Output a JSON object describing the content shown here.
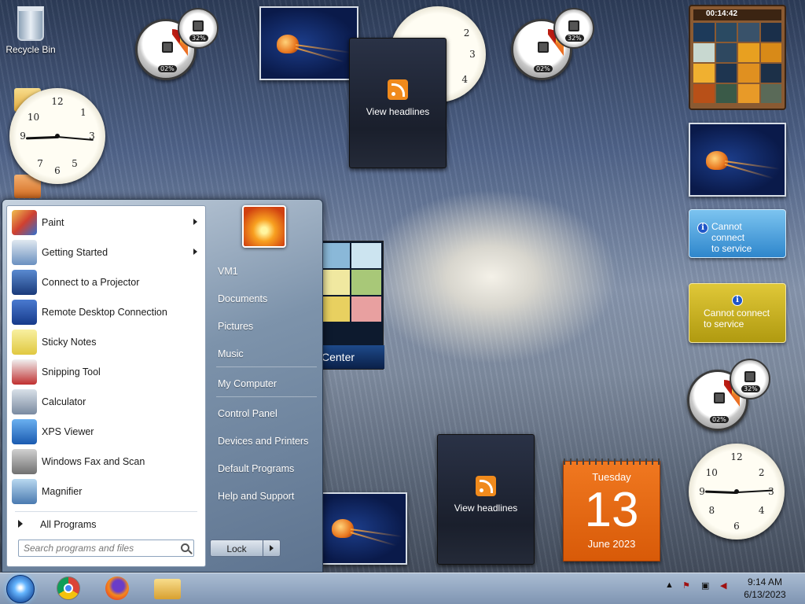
{
  "desktop": {
    "recycle_bin_label": "Recycle Bin",
    "meter_cpu": "02%",
    "meter_mem": "32%",
    "feed_label": "View headlines",
    "weather_msg_line1": "Cannot connect",
    "weather_msg_line2": "to service",
    "puzzle_time": "00:14:42",
    "media_center_label": "Center",
    "calendar_day": "Tuesday",
    "calendar_date": "13",
    "calendar_month": "June 2023"
  },
  "start_menu": {
    "programs": [
      {
        "label": "Paint",
        "icon": "paint-icon",
        "arrow": true
      },
      {
        "label": "Getting Started",
        "icon": "getting-started-icon",
        "arrow": true
      },
      {
        "label": "Connect to a Projector",
        "icon": "projector-icon",
        "arrow": false
      },
      {
        "label": "Remote Desktop Connection",
        "icon": "remote-desktop-icon",
        "arrow": false
      },
      {
        "label": "Sticky Notes",
        "icon": "sticky-notes-icon",
        "arrow": false
      },
      {
        "label": "Snipping Tool",
        "icon": "snipping-tool-icon",
        "arrow": false
      },
      {
        "label": "Calculator",
        "icon": "calculator-icon",
        "arrow": false
      },
      {
        "label": "XPS Viewer",
        "icon": "xps-viewer-icon",
        "arrow": false
      },
      {
        "label": "Windows Fax and Scan",
        "icon": "fax-scan-icon",
        "arrow": false
      },
      {
        "label": "Magnifier",
        "icon": "magnifier-icon",
        "arrow": false
      }
    ],
    "all_programs": "All Programs",
    "search_placeholder": "Search programs and files",
    "right_links": [
      "VM1",
      "Documents",
      "Pictures",
      "Music",
      "My Computer",
      "Control Panel",
      "Devices and Printers",
      "Default Programs",
      "Help and Support"
    ],
    "lock_label": "Lock"
  },
  "taskbar": {
    "apps": [
      "chrome-icon",
      "firefox-icon",
      "file-explorer-icon"
    ],
    "time": "9:14 AM",
    "date": "6/13/2023"
  },
  "colors": {
    "accent": "#f07820",
    "start_bg": "#7d93ab",
    "taskbar": "#a9bcd2"
  }
}
